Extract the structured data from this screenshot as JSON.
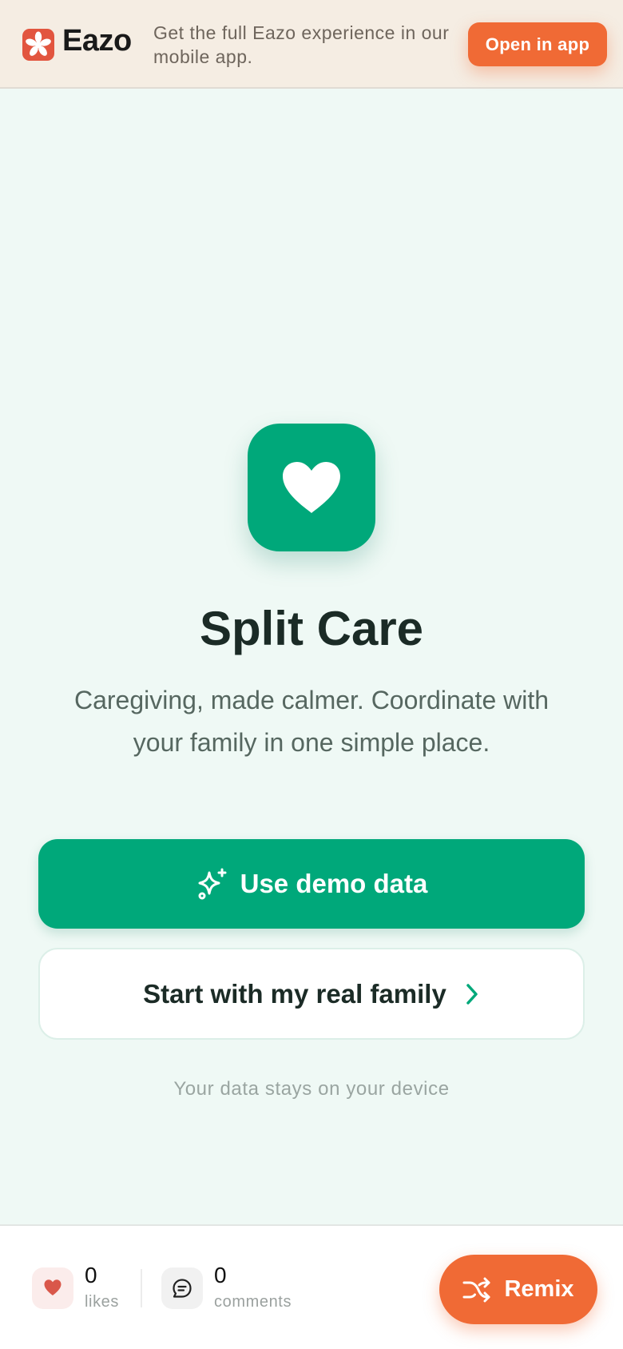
{
  "banner": {
    "brand_name": "Eazo",
    "message": "Get the full Eazo experience in our mobile app.",
    "open_app_label": "Open in app",
    "logo_icon": "asterisk-logo-icon"
  },
  "hero": {
    "icon": "heart-icon",
    "title": "Split Care",
    "subtitle": "Caregiving, made calmer. Coordinate with your family in one simple place."
  },
  "actions": {
    "demo_label": "Use demo data",
    "demo_icon": "sparkles-icon",
    "real_label": "Start with my real family",
    "real_icon": "chevron-right-icon"
  },
  "privacy_note": "Your data stays on your device",
  "social": {
    "likes_count": "0",
    "likes_label": "likes",
    "comments_count": "0",
    "comments_label": "comments",
    "remix_label": "Remix",
    "remix_icon": "shuffle-icon"
  },
  "colors": {
    "brand_green": "#00a87a",
    "accent_orange": "#f06a35",
    "page_background": "#eff9f5",
    "banner_background": "#f5ede3"
  }
}
